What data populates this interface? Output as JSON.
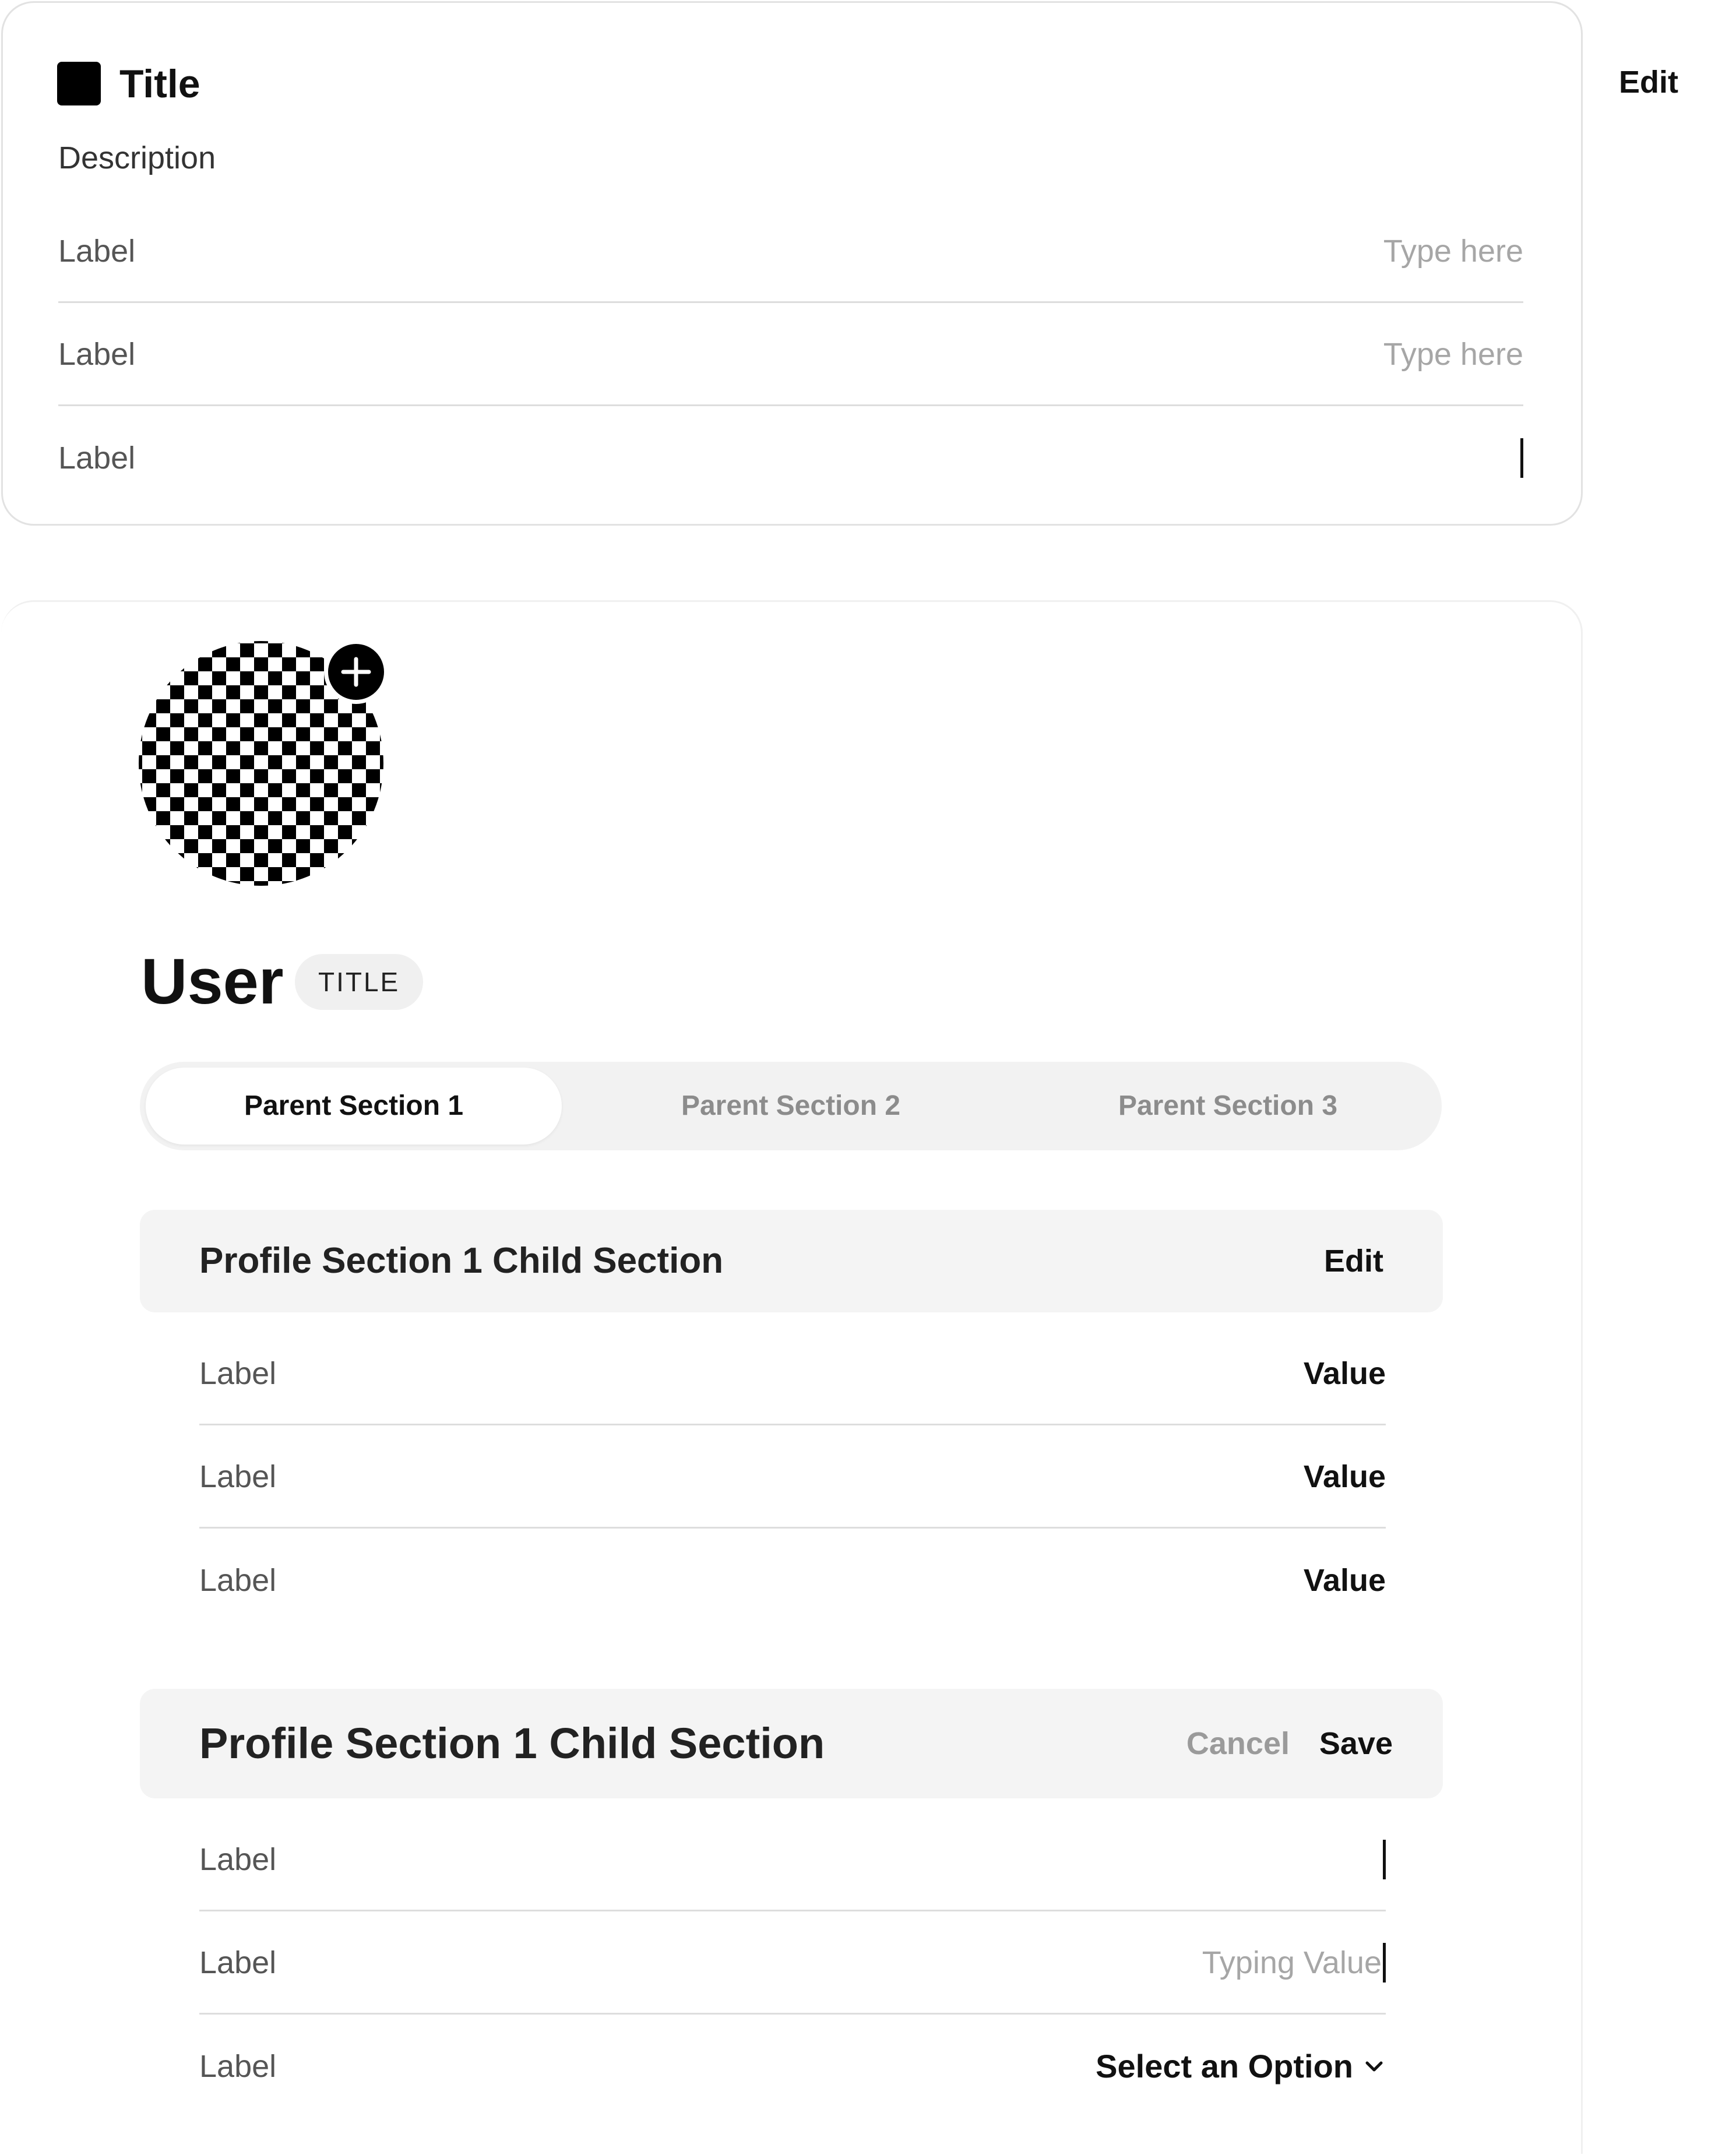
{
  "card": {
    "title": "Title",
    "edit_label": "Edit",
    "description": "Description",
    "fields": [
      {
        "label": "Label",
        "placeholder": "Type here"
      },
      {
        "label": "Label",
        "placeholder": "Type here"
      },
      {
        "label": "Label",
        "value": ""
      }
    ]
  },
  "profile": {
    "name": "User",
    "badge": "TITLE",
    "avatar_action_icon": "plus-icon",
    "tabs": [
      {
        "label": "Parent Section 1",
        "active": true
      },
      {
        "label": "Parent Section 2",
        "active": false
      },
      {
        "label": "Parent Section 3",
        "active": false
      }
    ],
    "section_view": {
      "title": "Profile Section 1 Child Section",
      "edit_label": "Edit",
      "rows": [
        {
          "label": "Label",
          "value": "Value"
        },
        {
          "label": "Label",
          "value": "Value"
        },
        {
          "label": "Label",
          "value": "Value"
        }
      ]
    },
    "section_edit": {
      "title": "Profile Section 1 Child Section",
      "cancel_label": "Cancel",
      "save_label": "Save",
      "rows": [
        {
          "label": "Label",
          "value": ""
        },
        {
          "label": "Label",
          "typing_value": "Typing Value"
        },
        {
          "label": "Label",
          "select_value": "Select an Option"
        }
      ]
    }
  }
}
